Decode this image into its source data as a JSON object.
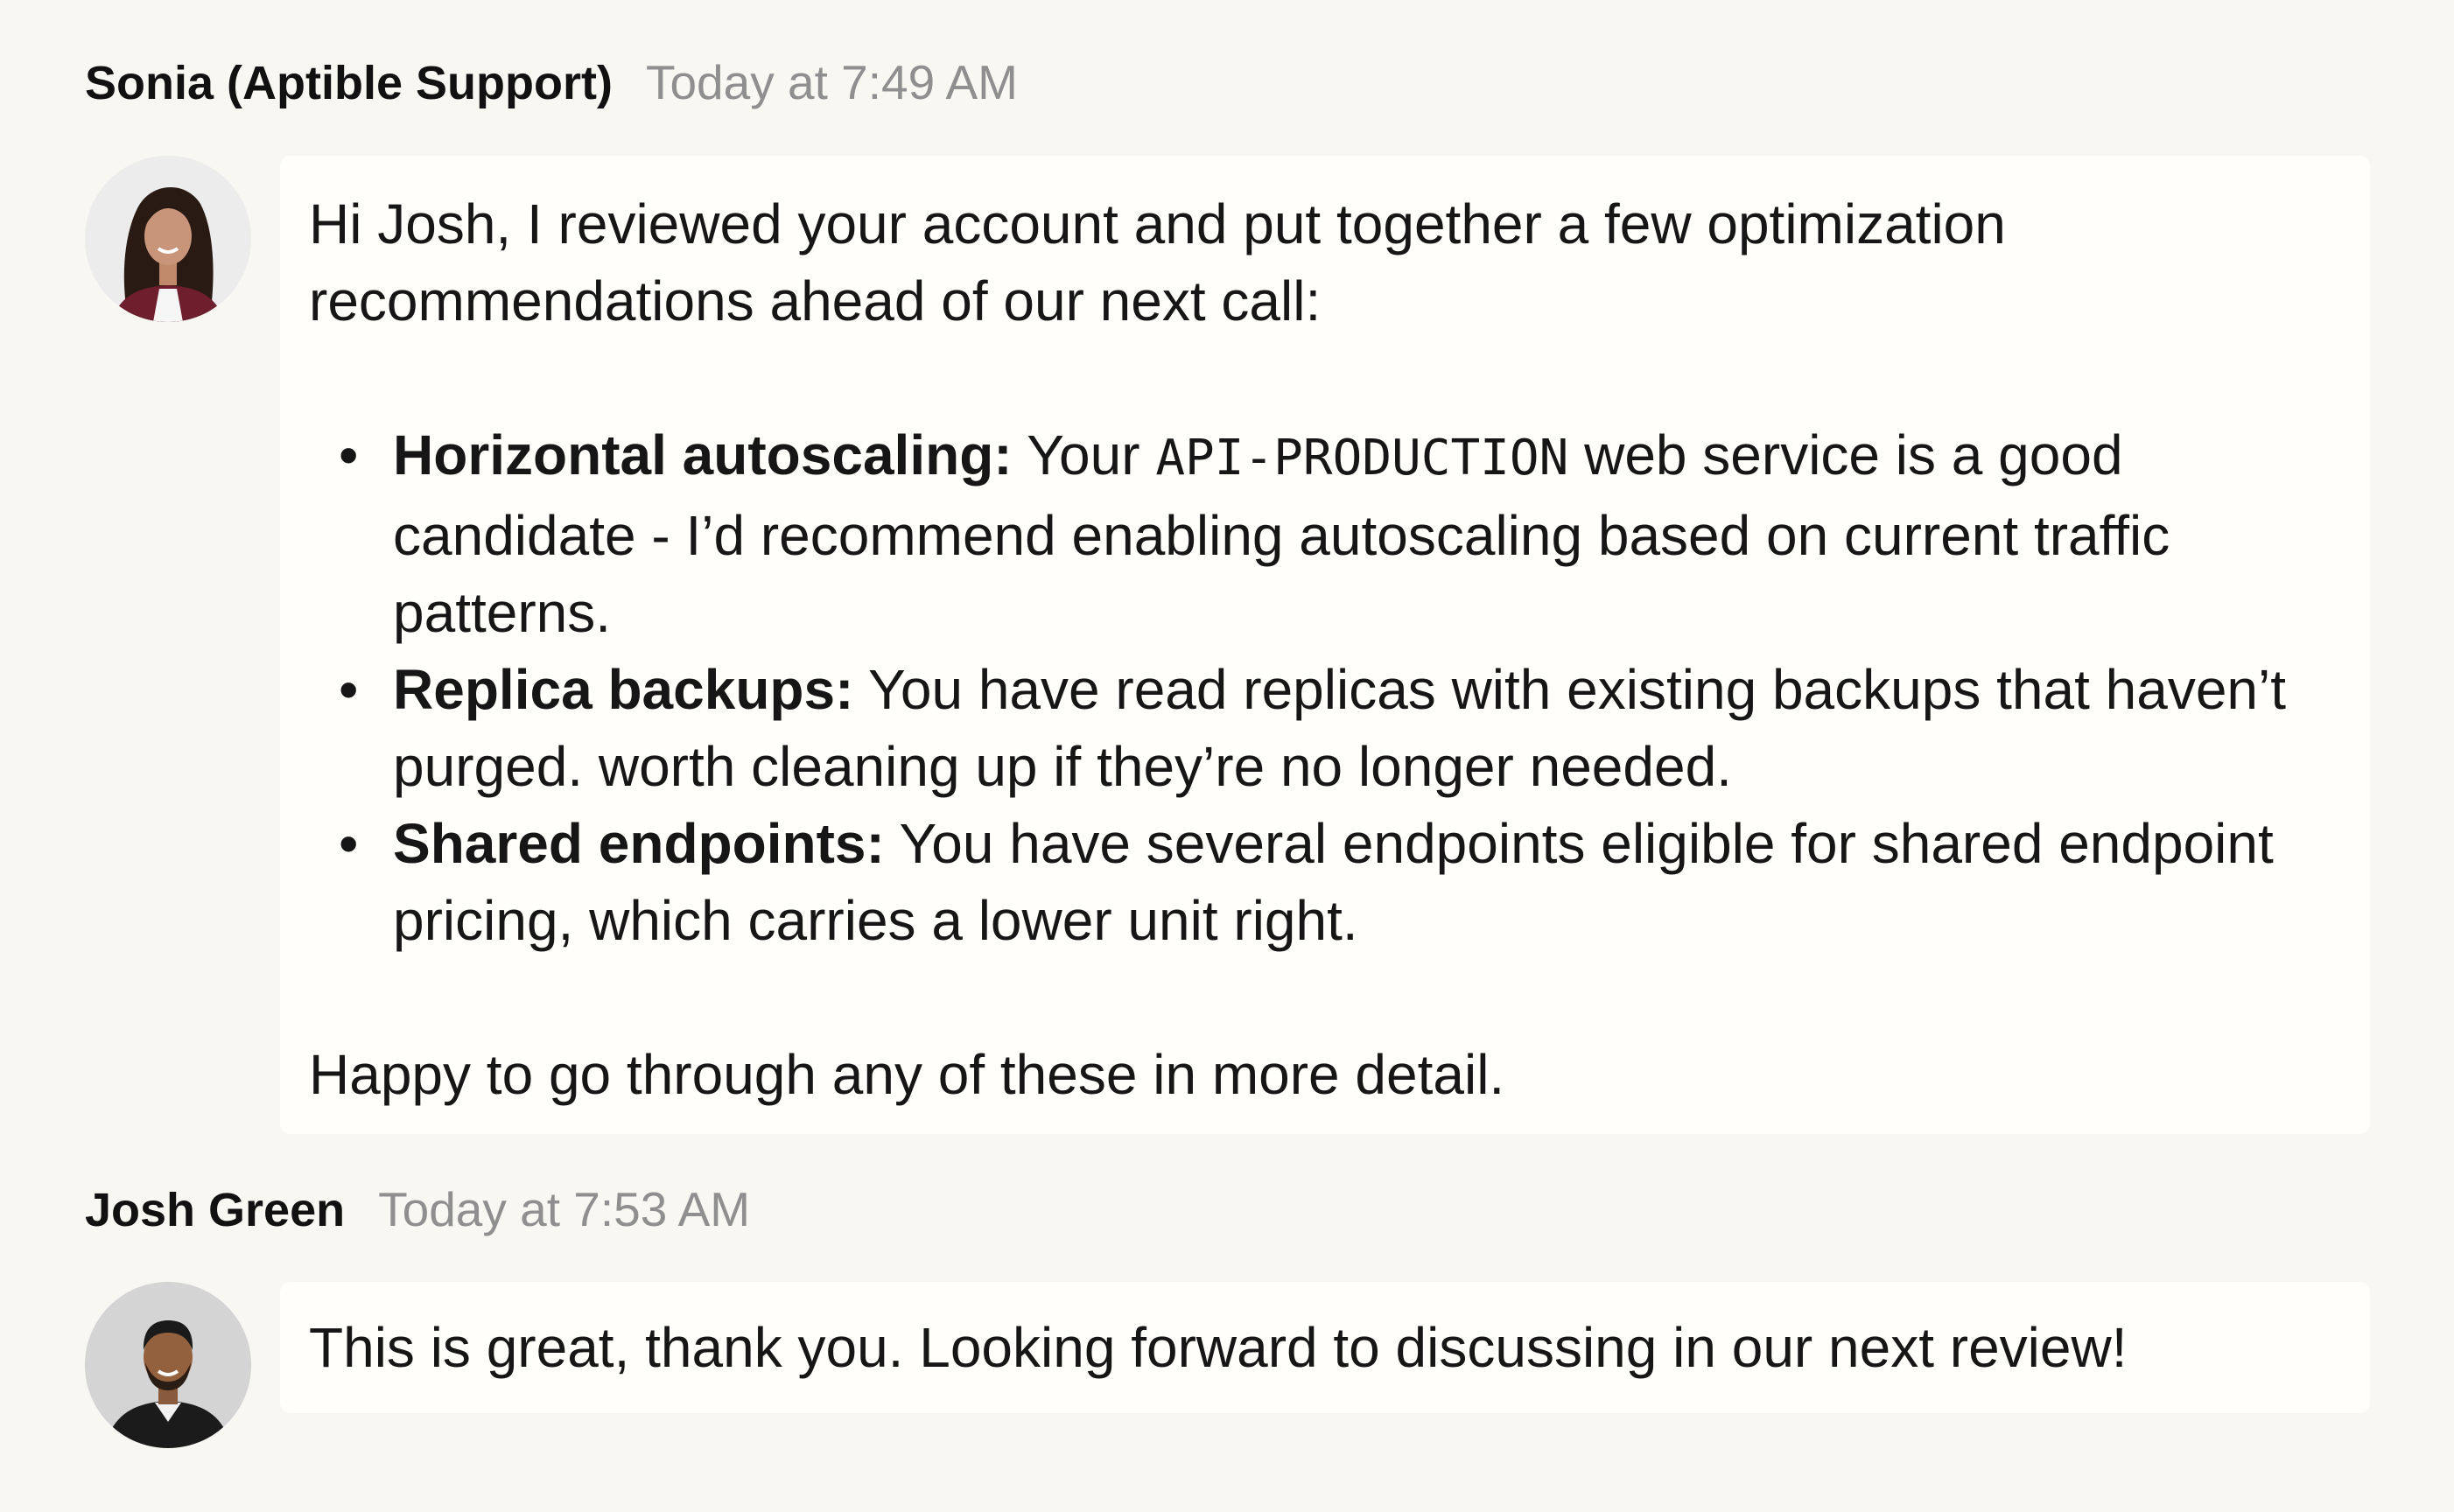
{
  "messages": [
    {
      "author": "Sonia (Aptible Support)",
      "timestamp": "Today at 7:49 AM",
      "avatar": "avatar-photo-woman",
      "intro": "Hi Josh, I reviewed your account and put together a few optimization recommendations ahead of our next call:",
      "bullets": [
        {
          "title": "Horizontal autoscaling:",
          "text_before": " Your ",
          "code": "API-PRODUCTION",
          "text_after": " web service is a good candidate - I’d recommend enabling autoscaling based on current traffic patterns."
        },
        {
          "title": "Replica backups:",
          "text": " You have read replicas with existing backups that haven’t purged. worth cleaning up if they’re no longer needed."
        },
        {
          "title": "Shared endpoints:",
          "text": " You have several endpoints eligible for shared endpoint pricing, which carries a lower unit right."
        }
      ],
      "outro": "Happy to go through any of these in more detail."
    },
    {
      "author": "Josh Green",
      "timestamp": "Today at 7:53 AM",
      "avatar": "avatar-photo-man",
      "text": "This is great, thank you. Looking forward to discussing in our next review!"
    }
  ],
  "bullet_glyph": "•",
  "colors": {
    "background": "#f9f7f1",
    "bubble": "#fffefa",
    "text": "#161616",
    "timestamp": "#8f8f8f"
  }
}
